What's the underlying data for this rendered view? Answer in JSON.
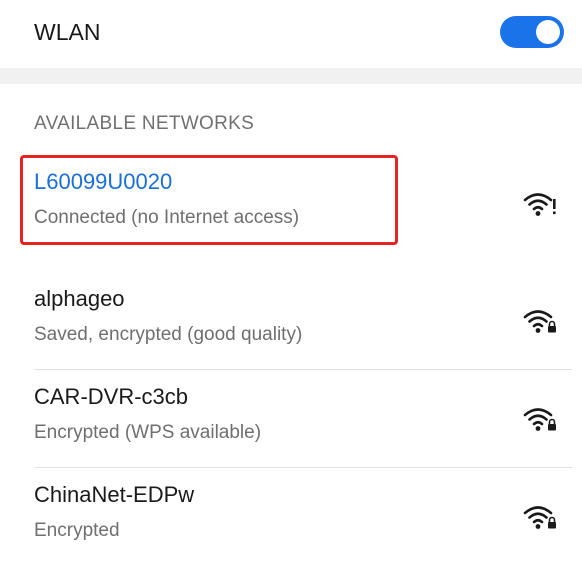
{
  "wlan": {
    "label": "WLAN",
    "enabled": true,
    "accent_color": "#1a73e8"
  },
  "section": {
    "title": "AVAILABLE NETWORKS"
  },
  "networks": [
    {
      "ssid": "L60099U0020",
      "status": "Connected (no Internet access)",
      "icon": "wifi-no-internet-icon",
      "connected": true
    },
    {
      "ssid": "alphageo",
      "status": "Saved, encrypted (good quality)",
      "icon": "wifi-locked-icon",
      "connected": false
    },
    {
      "ssid": "CAR-DVR-c3cb",
      "status": "Encrypted (WPS available)",
      "icon": "wifi-locked-icon",
      "connected": false
    },
    {
      "ssid": "ChinaNet-EDPw",
      "status": "Encrypted",
      "icon": "wifi-locked-icon",
      "connected": false
    }
  ],
  "highlight_color": "#e62424"
}
